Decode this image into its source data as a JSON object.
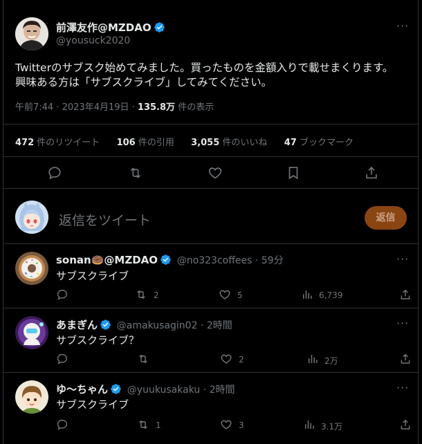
{
  "tweet": {
    "author_name": "前澤友作@MZDAO",
    "author_handle": "@yousuck2020",
    "text_line1": "Twitterのサブスク始めてみました。買ったものを金額入りで載せまくります。",
    "text_line2": "興味ある方は「サブスクライブ」してみてください。",
    "time": "午前7:44",
    "date": "2023年4月19日",
    "views_count": "135.8万",
    "views_label": "件の表示",
    "separator": " · "
  },
  "stats": {
    "retweets_count": "472",
    "retweets_label": "件のリツイート",
    "quotes_count": "106",
    "quotes_label": "件の引用",
    "likes_count": "3,055",
    "likes_label": "件のいいね",
    "bookmarks_count": "47",
    "bookmarks_label": "ブックマーク"
  },
  "reply_box": {
    "placeholder": "返信をツイート",
    "button_label": "返信"
  },
  "replies": [
    {
      "name": "sonan🍩@MZDAO",
      "handle": "@no323coffees",
      "time": "59分",
      "text": "サブスクライブ",
      "retweets": "2",
      "likes": "5",
      "views": "6,739"
    },
    {
      "name": "あまぎん",
      "handle": "@amakusagin02",
      "time": "2時間",
      "text": "サブスクライブ？",
      "retweets": "",
      "likes": "2",
      "views": "2万"
    },
    {
      "name": "ゆ〜ちゃん",
      "handle": "@yuukusakaku",
      "time": "2時間",
      "text": "サブスクライブ",
      "retweets": "1",
      "likes": "3",
      "views": "3.1万"
    }
  ],
  "colors": {
    "background": "#000000",
    "text": "#e7e9ea",
    "muted": "#71767b",
    "divider": "#2f3336",
    "verified": "#1d9bf0",
    "reply_button": "#8b4513"
  }
}
